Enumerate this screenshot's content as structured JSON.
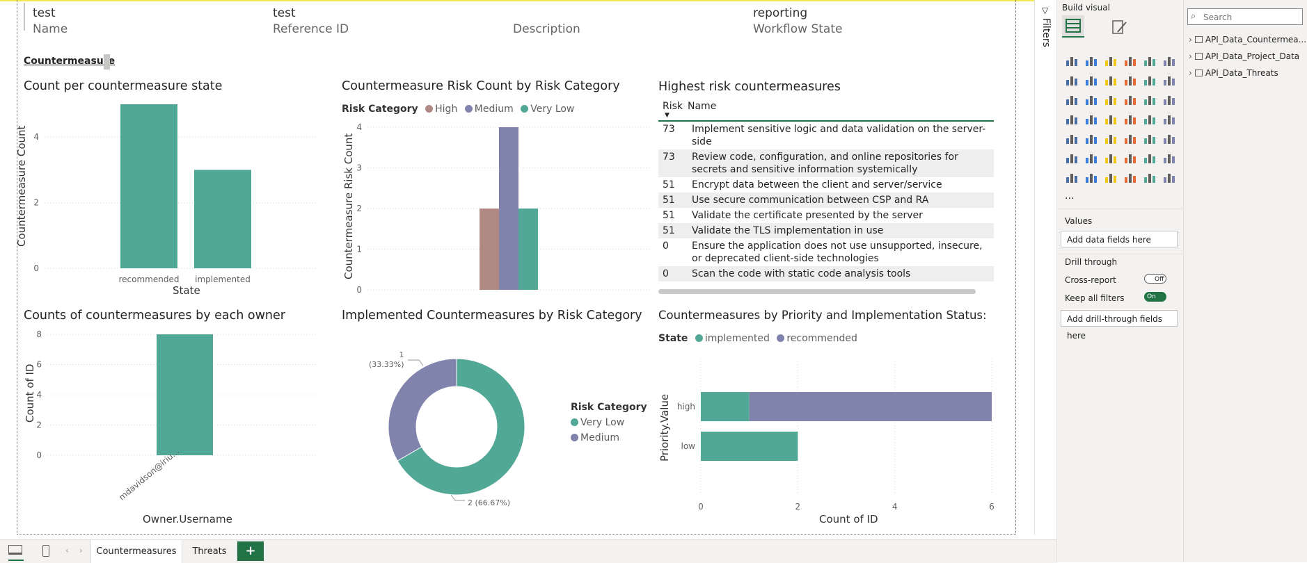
{
  "header": {
    "cards": [
      {
        "value": "test",
        "label": "Name"
      },
      {
        "value": "test",
        "label": "Reference ID"
      },
      {
        "value": "",
        "label": "Description"
      },
      {
        "value": "reporting",
        "label": "Workflow State"
      }
    ],
    "page_button": "Countermeasure"
  },
  "visuals": {
    "state_chart": {
      "title": "Count per countermeasure state",
      "chart_data": {
        "type": "bar",
        "categories": [
          "recommended",
          "implemented"
        ],
        "values": [
          5,
          3
        ],
        "xlabel": "State",
        "ylabel": "Countermeasure Count",
        "ylim": [
          0,
          5
        ],
        "yticks": [
          "4",
          "2",
          "0"
        ],
        "color": "#52a896"
      }
    },
    "risk_category_chart": {
      "title": "Countermeasure Risk Count by Risk Category",
      "legend_title": "Risk Category",
      "chart_data": {
        "type": "bar",
        "series": [
          {
            "name": "High",
            "values": [
              2
            ],
            "color": "#b08985"
          },
          {
            "name": "Medium",
            "values": [
              4
            ],
            "color": "#8084ac"
          },
          {
            "name": "Very Low",
            "values": [
              2
            ],
            "color": "#52a896"
          }
        ],
        "ylabel": "Countermeasure Risk Count",
        "ylim": [
          0,
          4
        ],
        "yticks": [
          "4",
          "3",
          "2",
          "1",
          "0"
        ]
      }
    },
    "highest_risk_table": {
      "title": "Highest risk countermeasures",
      "columns": [
        "Risk",
        "Name"
      ],
      "rows": [
        {
          "risk": "73",
          "name": "Implement sensitive logic and data validation on the server-side"
        },
        {
          "risk": "73",
          "name": "Review code, configuration, and online repositories for secrets and sensitive information systemically"
        },
        {
          "risk": "51",
          "name": "Encrypt data between the client and server/service"
        },
        {
          "risk": "51",
          "name": "Use secure communication between CSP and RA"
        },
        {
          "risk": "51",
          "name": "Validate the certificate presented by the server"
        },
        {
          "risk": "51",
          "name": "Validate the TLS implementation in use"
        },
        {
          "risk": "0",
          "name": "Ensure the application does not use unsupported, insecure, or deprecated client-side technologies"
        },
        {
          "risk": "0",
          "name": "Scan the code with static code analysis tools"
        }
      ]
    },
    "owner_chart": {
      "title": "Counts of countermeasures by each owner",
      "chart_data": {
        "type": "bar",
        "categories": [
          "mdavidson@iriu..."
        ],
        "values": [
          8
        ],
        "xlabel": "Owner.Username",
        "ylabel": "Count of ID",
        "ylim": [
          0,
          8
        ],
        "yticks": [
          "8",
          "6",
          "4",
          "2",
          "0"
        ],
        "color": "#52a896"
      }
    },
    "implemented_donut": {
      "title": "Implemented Countermeasures by Risk Category",
      "legend_title": "Risk Category",
      "chart_data": {
        "type": "pie",
        "slices": [
          {
            "name": "Very Low",
            "value": 2,
            "label": "2 (66.67%)",
            "color": "#52a896"
          },
          {
            "name": "Medium",
            "value": 1,
            "label": "1 (33.33%)",
            "color": "#8084ac"
          }
        ]
      }
    },
    "priority_chart": {
      "title": "Countermeasures by Priority and Implementation Status:",
      "legend_title": "State",
      "chart_data": {
        "type": "bar",
        "orientation": "horizontal",
        "categories": [
          "high",
          "low"
        ],
        "series": [
          {
            "name": "implemented",
            "values": [
              1,
              2
            ],
            "color": "#52a896"
          },
          {
            "name": "recommended",
            "values": [
              5,
              0
            ],
            "color": "#8084ac"
          }
        ],
        "xlabel": "Count of ID",
        "ylabel": "Priority.Value",
        "xlim": [
          0,
          6
        ],
        "xticks": [
          "0",
          "2",
          "4",
          "6"
        ]
      }
    }
  },
  "filters_pane": {
    "label": "Filters"
  },
  "visualizations_pane": {
    "title": "Build visual",
    "values_label": "Values",
    "values_well": "Add data fields here",
    "drill_label": "Drill through",
    "cross_report": "Cross-report",
    "cross_report_state": "Off",
    "keep_filters": "Keep all filters",
    "keep_filters_state": "On",
    "drill_well": "Add drill-through fields here",
    "more": "..."
  },
  "data_pane": {
    "search_placeholder": "Search",
    "tables": [
      "API_Data_Countermea...",
      "API_Data_Project_Data",
      "API_Data_Threats"
    ]
  },
  "page_tabs": {
    "tabs": [
      "Countermeasures",
      "Threats"
    ],
    "add": "+"
  },
  "colors": {
    "teal": "#52a896",
    "purple": "#8084ac",
    "rose": "#b08985",
    "accent": "#217346"
  }
}
